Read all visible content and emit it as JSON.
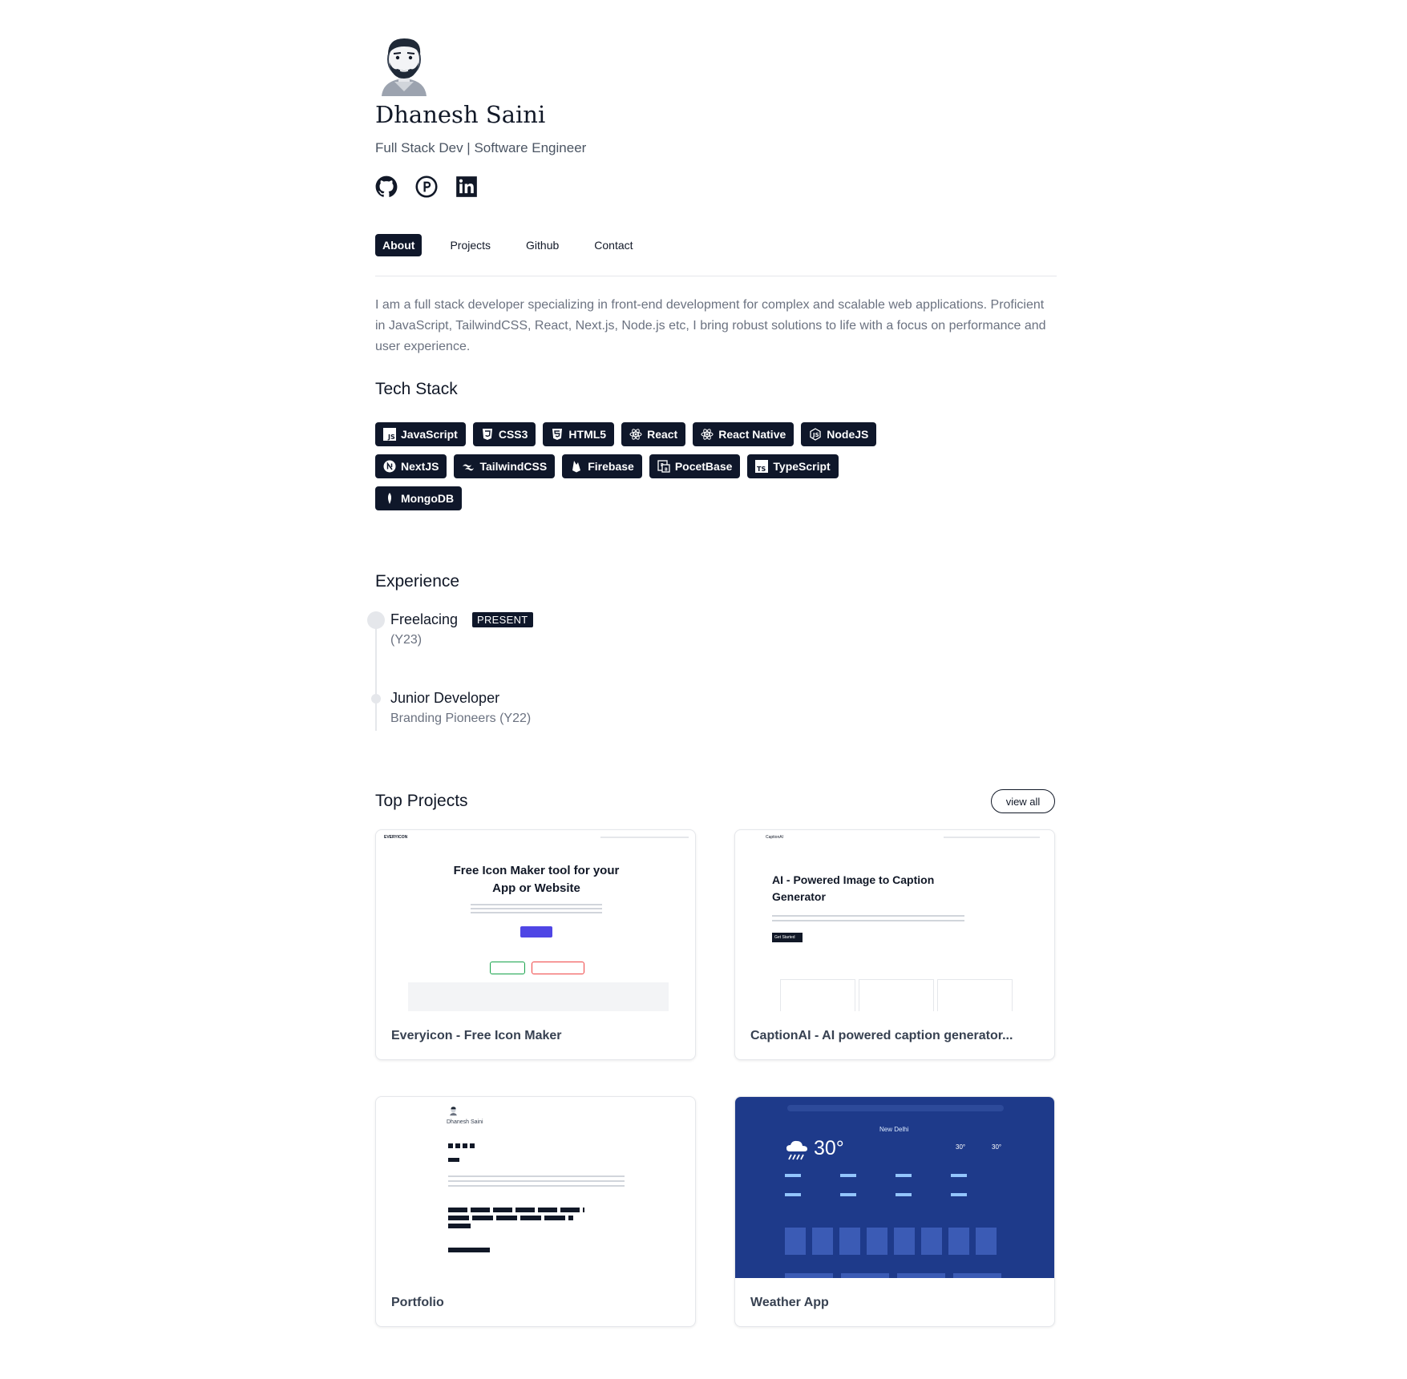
{
  "profile": {
    "name": "Dhanesh Saini",
    "role": "Full Stack Dev | Software Engineer",
    "socials": [
      {
        "icon": "github-icon"
      },
      {
        "icon": "producthunt-icon"
      },
      {
        "icon": "linkedin-icon"
      }
    ]
  },
  "nav": {
    "tabs": [
      {
        "label": "About",
        "active": true
      },
      {
        "label": "Projects",
        "active": false
      },
      {
        "label": "Github",
        "active": false
      },
      {
        "label": "Contact",
        "active": false
      }
    ]
  },
  "about": {
    "text": "I am a full stack developer specializing in front-end development for complex and scalable web applications. Proficient in JavaScript, TailwindCSS, React, Next.js, Node.js etc, I bring robust solutions to life with a focus on performance and user experience."
  },
  "tech": {
    "heading": "Tech Stack",
    "items": [
      "JavaScript",
      "CSS3",
      "HTML5",
      "React",
      "React Native",
      "NodeJS",
      "NextJS",
      "TailwindCSS",
      "Firebase",
      "PocetBase",
      "TypeScript",
      "MongoDB"
    ]
  },
  "experience": {
    "heading": "Experience",
    "items": [
      {
        "title": "Freelacing",
        "badge": "PRESENT",
        "sub": "(Y23)"
      },
      {
        "title": "Junior Developer",
        "sub": "Branding Pioneers (Y22)"
      }
    ]
  },
  "projects": {
    "heading": "Top Projects",
    "view_all": "view all",
    "items": [
      {
        "title": "Everyicon - Free Icon Maker",
        "thumb": {
          "brand": "EVERYICON",
          "headline": "Free Icon Maker tool for your App or Website"
        }
      },
      {
        "title": "CaptionAI - AI powered caption generator...",
        "thumb": {
          "brand": "CaptionAI",
          "headline": "AI - Powered Image to Caption Generator",
          "button": "Get Started"
        }
      },
      {
        "title": "Portfolio",
        "thumb": {
          "name": "Dhanesh Saini"
        }
      },
      {
        "title": "Weather App",
        "thumb": {
          "city": "New Delhi",
          "temp": "30°",
          "stat_a": "30°",
          "stat_b": "30°"
        }
      }
    ]
  },
  "colors": {
    "primary": "#0f172a",
    "muted": "#6b7280",
    "border": "#e5e7eb",
    "weather_bg": "#1e3a8a"
  }
}
